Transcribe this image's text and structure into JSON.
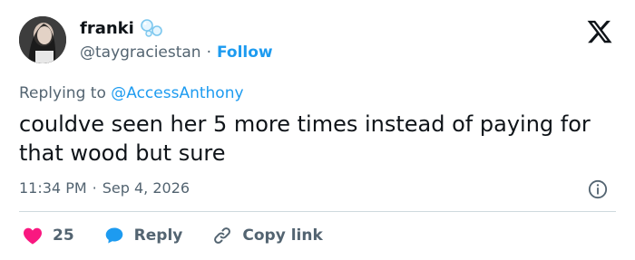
{
  "user": {
    "display_name": "franki",
    "handle": "@taygraciestan",
    "follow_label": "Follow",
    "separator": "·"
  },
  "reply_context": {
    "prefix": "Replying to ",
    "mention": "@AccessAnthony"
  },
  "tweet": {
    "text": "couldve seen her 5 more times instead of paying for that wood but sure",
    "time": "11:34 PM",
    "date": "Sep 4, 2026",
    "meta_separator": "·"
  },
  "actions": {
    "like_count": "25",
    "reply_label": "Reply",
    "copy_link_label": "Copy link"
  },
  "colors": {
    "accent": "#1d9bf0",
    "secondary_text": "#536471",
    "primary_text": "#0f1419",
    "like": "#f91880",
    "divider": "#cfd9de"
  },
  "icons": [
    "bubbles-emoji-icon",
    "x-logo-icon",
    "info-icon",
    "heart-icon",
    "reply-bubble-icon",
    "link-icon"
  ]
}
